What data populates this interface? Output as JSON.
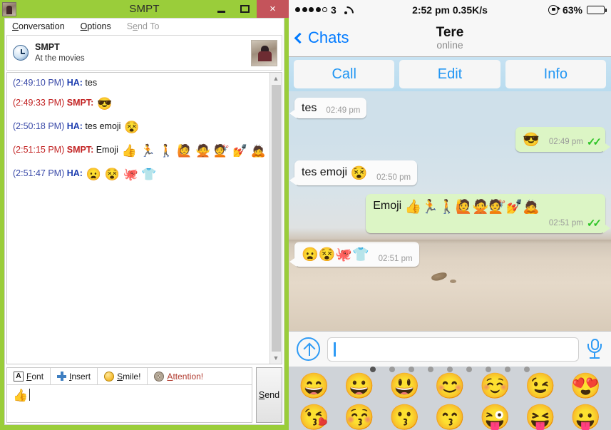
{
  "window": {
    "title": "SMPT",
    "app_icon": "photo-thumbnail-icon",
    "minimize_label": "–",
    "maximize_label": "□",
    "close_label": "×",
    "accent_green": "#9ACD3A",
    "close_red": "#C4545B"
  },
  "menu": {
    "items": [
      {
        "label": "Conversation",
        "accel": "C",
        "disabled": false
      },
      {
        "label": "Options",
        "accel": "O",
        "disabled": false
      },
      {
        "label": "Send To",
        "accel": "S",
        "disabled": true
      }
    ]
  },
  "conversation_header": {
    "icon": "clock-icon",
    "name": "SMPT",
    "status": "At the movies",
    "avatar": "contact-photo"
  },
  "messages": [
    {
      "time": "(2:49:10 PM)",
      "sender": "HA:",
      "side": "them",
      "text": "tes",
      "emojis": ""
    },
    {
      "time": "(2:49:33 PM)",
      "sender": "SMPT:",
      "side": "me",
      "text": "",
      "emojis": "😎"
    },
    {
      "time": "(2:50:18 PM)",
      "sender": "HA:",
      "side": "them",
      "text": "tes emoji",
      "emojis": "😵"
    },
    {
      "time": "(2:51:15 PM)",
      "sender": "SMPT:",
      "side": "me",
      "text": "Emoji",
      "emojis": "👍 🏃 🚶 🙋 🙅 💇 💅 🙇"
    },
    {
      "time": "(2:51:47 PM)",
      "sender": "HA:",
      "side": "them",
      "text": "",
      "emojis": "😦 😵 🐙 👕"
    }
  ],
  "scrollbar": {
    "up": "▲",
    "down": "▼"
  },
  "composer": {
    "tools": [
      {
        "label": "Font",
        "accel": "F",
        "icon": "font-icon"
      },
      {
        "label": "Insert",
        "accel": "I",
        "icon": "plus-icon"
      },
      {
        "label": "Smile!",
        "accel": "S",
        "icon": "smiley-icon"
      },
      {
        "label": "Attention!",
        "accel": "A",
        "icon": "attention-icon"
      }
    ],
    "input_value": "👍",
    "send_label": "Send"
  },
  "ios": {
    "statusbar": {
      "signal_dots": [
        true,
        true,
        true,
        true,
        false
      ],
      "carrier": "3",
      "wifi": "wifi-icon",
      "time": "2:52 pm",
      "network_speed": "0.35K/s",
      "rotation_lock": "rotation-lock-icon",
      "battery_percent": "63%",
      "battery_level": 63
    },
    "navbar": {
      "back_label": "Chats",
      "title": "Tere",
      "subtitle": "online"
    },
    "actions": [
      {
        "label": "Call"
      },
      {
        "label": "Edit"
      },
      {
        "label": "Info"
      }
    ],
    "bubbles": [
      {
        "side": "in",
        "text": "tes",
        "emojis": "",
        "time": "02:49 pm",
        "ticks": false,
        "wrapmeta": false
      },
      {
        "side": "out",
        "text": "",
        "emojis": "😎",
        "time": "02:49 pm",
        "ticks": true,
        "wrapmeta": false
      },
      {
        "side": "in",
        "text": "tes emoji",
        "emojis": "😵",
        "time": "02:50 pm",
        "ticks": false,
        "wrapmeta": false
      },
      {
        "side": "out",
        "text": "Emoji",
        "emojis": "👍🏃🚶🙋🙅💇💅🙇",
        "time": "02:51 pm",
        "ticks": true,
        "wrapmeta": true
      },
      {
        "side": "in",
        "text": "",
        "emojis": "😦😵🐙👕",
        "time": "02:51 pm",
        "ticks": false,
        "wrapmeta": false
      }
    ],
    "inputbar": {
      "attach_icon": "send-up-arrow-icon",
      "field_value": "",
      "field_placeholder": "",
      "mic_icon": "microphone-icon"
    },
    "keyboard": {
      "page_count": 9,
      "active_page": 1,
      "emoji_row1": [
        "😄",
        "😀",
        "😃",
        "😊",
        "☺️",
        "😉",
        "😍"
      ],
      "emoji_row2": [
        "😘",
        "😚",
        "😗",
        "😙",
        "😜",
        "😝",
        "😛"
      ]
    }
  }
}
